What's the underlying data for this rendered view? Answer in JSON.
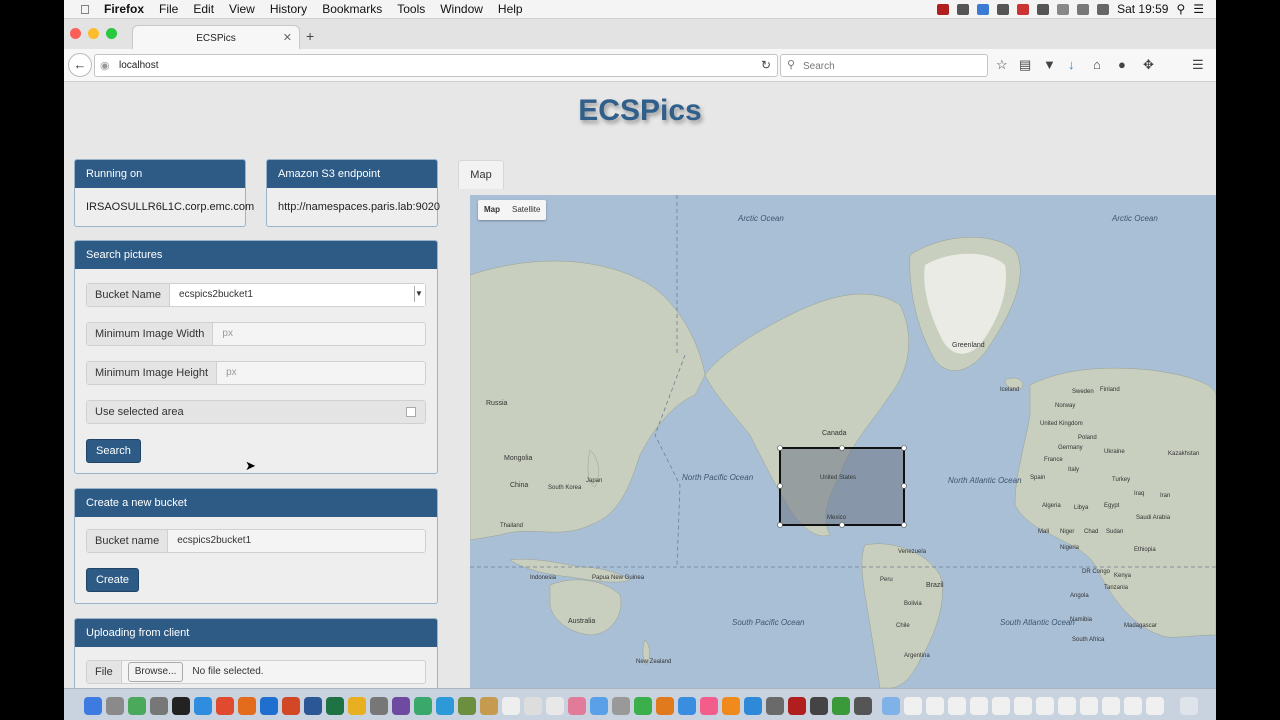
{
  "menubar": {
    "app": "Firefox",
    "items": [
      "File",
      "Edit",
      "View",
      "History",
      "Bookmarks",
      "Tools",
      "Window",
      "Help"
    ],
    "clock": "Sat 19:59"
  },
  "browser": {
    "tab_title": "ECSPics",
    "url": "localhost",
    "search_placeholder": "Search"
  },
  "page": {
    "title": "ECSPics",
    "running_on": {
      "label": "Running on",
      "value": "IRSAOSULLR6L1C.corp.emc.com"
    },
    "s3_endpoint": {
      "label": "Amazon S3 endpoint",
      "value": "http://namespaces.paris.lab:9020"
    },
    "search_panel": {
      "title": "Search pictures",
      "bucket_label": "Bucket Name",
      "bucket_value": "ecspics2bucket1",
      "min_width_label": "Minimum Image Width",
      "min_width_placeholder": "px",
      "min_height_label": "Minimum Image Height",
      "min_height_placeholder": "px",
      "use_area_label": "Use selected area",
      "search_button": "Search"
    },
    "create_panel": {
      "title": "Create a new bucket",
      "bucket_label": "Bucket name",
      "bucket_value": "ecspics2bucket1",
      "create_button": "Create"
    },
    "upload_panel": {
      "title": "Uploading from client",
      "file_label": "File",
      "browse_button": "Browse...",
      "file_status": "No file selected."
    },
    "map": {
      "tab": "Map",
      "type_map": "Map",
      "type_satellite": "Satellite",
      "labels": {
        "arctic_ocean_1": "Arctic Ocean",
        "arctic_ocean_2": "Arctic Ocean",
        "greenland": "Greenland",
        "russia": "Russia",
        "mongolia": "Mongolia",
        "china": "China",
        "south_korea": "South Korea",
        "japan": "Japan",
        "thailand": "Thailand",
        "indonesia": "Indonesia",
        "papua": "Papua New Guinea",
        "australia": "Australia",
        "new_zealand": "New Zealand",
        "north_pacific": "North Pacific Ocean",
        "south_pacific": "South Pacific Ocean",
        "canada": "Canada",
        "united_states": "United States",
        "mexico": "Mexico",
        "venezuela": "Venezuela",
        "peru": "Peru",
        "brazil": "Brazil",
        "bolivia": "Bolivia",
        "chile": "Chile",
        "argentina": "Argentina",
        "iceland": "Iceland",
        "north_atlantic": "North Atlantic Ocean",
        "south_atlantic": "South Atlantic Ocean",
        "sweden": "Sweden",
        "norway": "Norway",
        "finland": "Finland",
        "united_kingdom": "United Kingdom",
        "poland": "Poland",
        "germany": "Germany",
        "france": "France",
        "spain": "Spain",
        "italy": "Italy",
        "ukraine": "Ukraine",
        "kazakhstan": "Kazakhstan",
        "turkey": "Turkey",
        "iraq": "Iraq",
        "iran": "Iran",
        "algeria": "Algeria",
        "libya": "Libya",
        "egypt": "Egypt",
        "saudi_arabia": "Saudi Arabia",
        "mali": "Mali",
        "niger": "Niger",
        "chad": "Chad",
        "sudan": "Sudan",
        "nigeria": "Nigeria",
        "ethiopia": "Ethiopia",
        "kenya": "Kenya",
        "drc": "DR Congo",
        "tanzania": "Tanzania",
        "angola": "Angola",
        "namibia": "Namibia",
        "madagascar": "Madagascar",
        "south_africa": "South Africa"
      }
    }
  }
}
